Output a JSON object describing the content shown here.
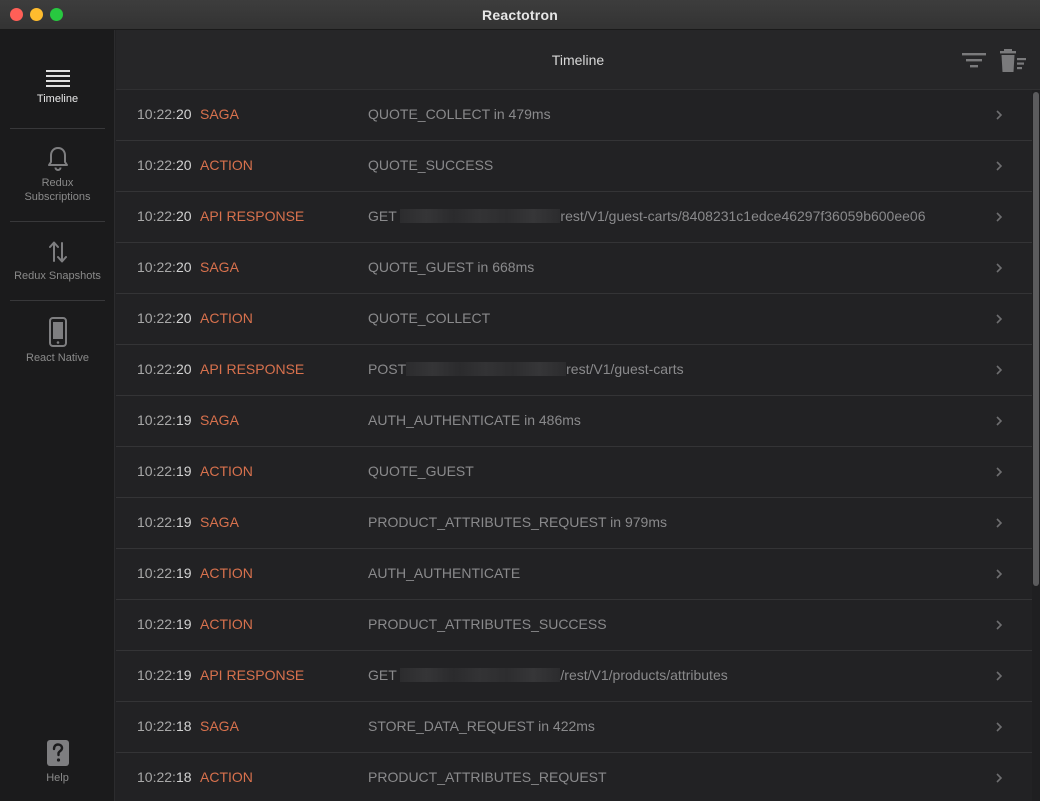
{
  "window": {
    "title": "Reactotron"
  },
  "sidebar": {
    "items": [
      {
        "label": "Timeline",
        "icon": "hamburger-icon",
        "active": true
      },
      {
        "label": "Redux\nSubscriptions",
        "icon": "bell-icon",
        "active": false
      },
      {
        "label": "Redux Snapshots",
        "icon": "swap-arrows-icon",
        "active": false
      },
      {
        "label": "React Native",
        "icon": "phone-icon",
        "active": false
      }
    ],
    "help": {
      "label": "Help",
      "icon": "help-icon"
    }
  },
  "header": {
    "title": "Timeline",
    "actions": [
      {
        "name": "filter",
        "icon": "filter-icon"
      },
      {
        "name": "clear",
        "icon": "trash-icon"
      }
    ]
  },
  "colors": {
    "type_accent": "#d8714d",
    "background": "#222224",
    "sidebar": "#1b1b1c"
  },
  "timeline": [
    {
      "time_hm": "10:22:",
      "time_s": "20",
      "type": "SAGA",
      "pre": "QUOTE_COLLECT in 479ms",
      "post": ""
    },
    {
      "time_hm": "10:22:",
      "time_s": "20",
      "type": "ACTION",
      "pre": "QUOTE_SUCCESS",
      "post": ""
    },
    {
      "time_hm": "10:22:",
      "time_s": "20",
      "type": "API RESPONSE",
      "pre": "GET ",
      "post": "rest/V1/guest-carts/8408231c1edce46297f36059b600ee06"
    },
    {
      "time_hm": "10:22:",
      "time_s": "20",
      "type": "SAGA",
      "pre": "QUOTE_GUEST in 668ms",
      "post": ""
    },
    {
      "time_hm": "10:22:",
      "time_s": "20",
      "type": "ACTION",
      "pre": "QUOTE_COLLECT",
      "post": ""
    },
    {
      "time_hm": "10:22:",
      "time_s": "20",
      "type": "API RESPONSE",
      "pre": "POST",
      "post": "rest/V1/guest-carts"
    },
    {
      "time_hm": "10:22:",
      "time_s": "19",
      "type": "SAGA",
      "pre": "AUTH_AUTHENTICATE in 486ms",
      "post": ""
    },
    {
      "time_hm": "10:22:",
      "time_s": "19",
      "type": "ACTION",
      "pre": "QUOTE_GUEST",
      "post": ""
    },
    {
      "time_hm": "10:22:",
      "time_s": "19",
      "type": "SAGA",
      "pre": "PRODUCT_ATTRIBUTES_REQUEST in 979ms",
      "post": ""
    },
    {
      "time_hm": "10:22:",
      "time_s": "19",
      "type": "ACTION",
      "pre": "AUTH_AUTHENTICATE",
      "post": ""
    },
    {
      "time_hm": "10:22:",
      "time_s": "19",
      "type": "ACTION",
      "pre": "PRODUCT_ATTRIBUTES_SUCCESS",
      "post": ""
    },
    {
      "time_hm": "10:22:",
      "time_s": "19",
      "type": "API RESPONSE",
      "pre": "GET ",
      "post": "/rest/V1/products/attributes"
    },
    {
      "time_hm": "10:22:",
      "time_s": "18",
      "type": "SAGA",
      "pre": "STORE_DATA_REQUEST in 422ms",
      "post": ""
    },
    {
      "time_hm": "10:22:",
      "time_s": "18",
      "type": "ACTION",
      "pre": "PRODUCT_ATTRIBUTES_REQUEST",
      "post": ""
    }
  ]
}
